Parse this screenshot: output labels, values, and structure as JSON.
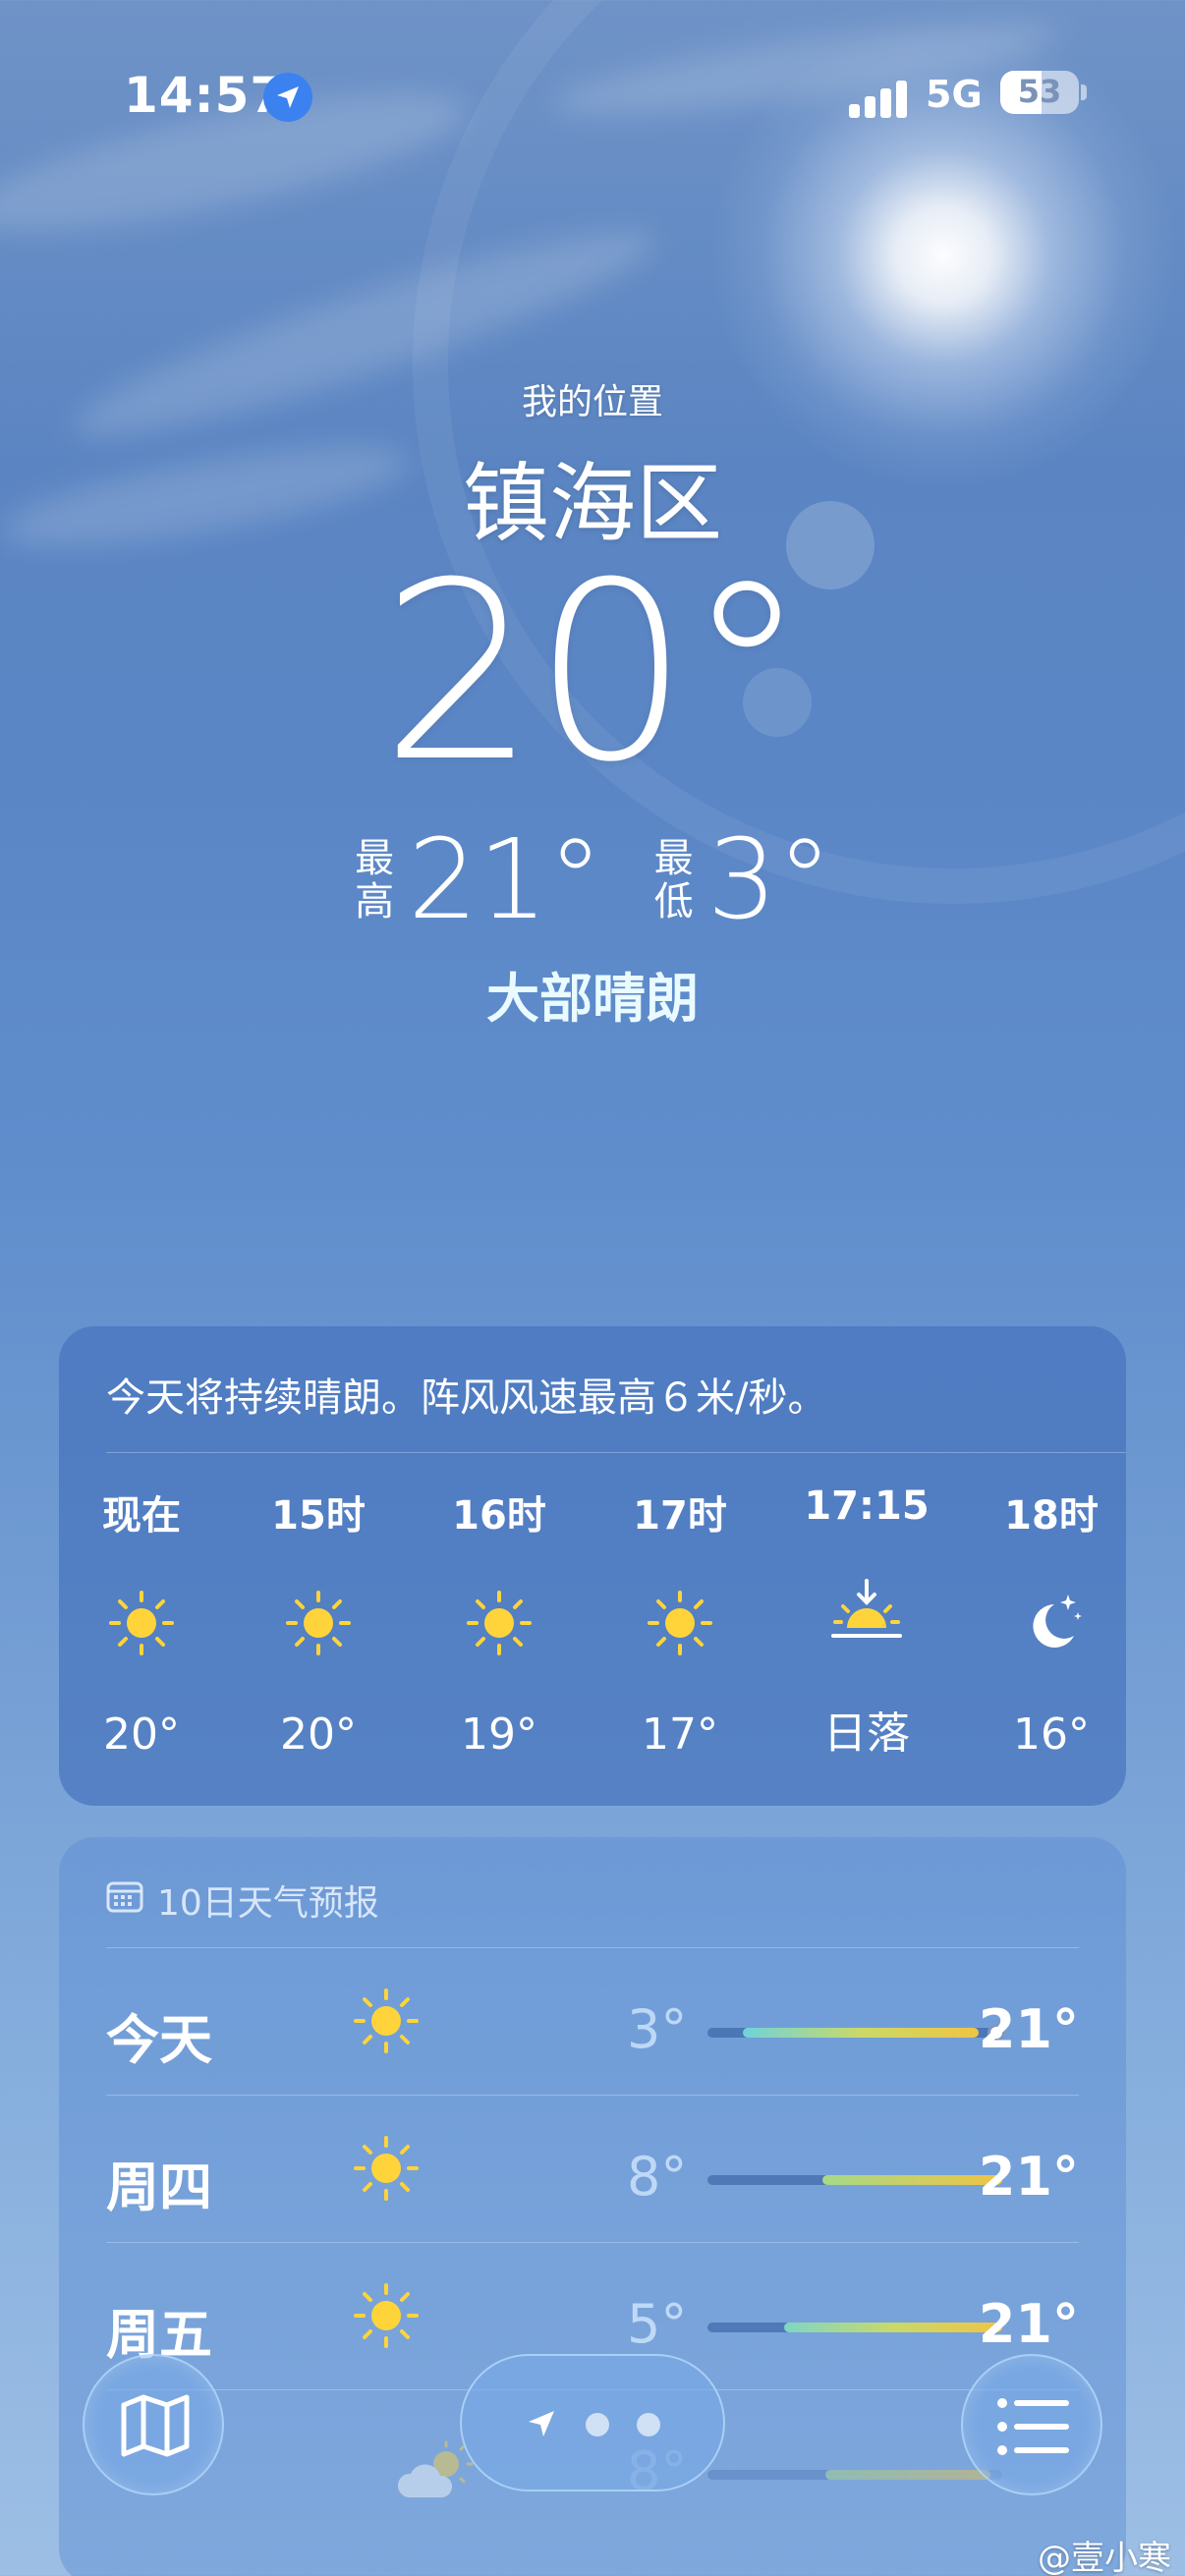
{
  "status_bar": {
    "time": "14:57",
    "network": "5G",
    "battery_level": "53",
    "battery_fraction": 0.53
  },
  "location": {
    "my_location_label": "我的位置",
    "city": "镇海区"
  },
  "current": {
    "temperature": "20°",
    "high_label": "最高",
    "high": "21°",
    "low_label": "最低",
    "low": "3°",
    "condition": "大部晴朗"
  },
  "hourly": {
    "summary": "今天将持续晴朗。阵风风速最高６米/秒。",
    "items": [
      {
        "time": "现在",
        "icon": "sun-icon",
        "temp": "20°"
      },
      {
        "time": "15时",
        "icon": "sun-icon",
        "temp": "20°"
      },
      {
        "time": "16时",
        "icon": "sun-icon",
        "temp": "19°"
      },
      {
        "time": "17时",
        "icon": "sun-icon",
        "temp": "17°"
      },
      {
        "time": "17:15",
        "icon": "sunset-icon",
        "temp": "日落"
      },
      {
        "time": "18时",
        "icon": "moon-stars-icon",
        "temp": "16°"
      }
    ]
  },
  "daily": {
    "title": "10日天气预报",
    "days": [
      {
        "day": "今天",
        "icon": "sun-icon",
        "low": "3°",
        "high": "21°",
        "range_start": 0.12,
        "range_end": 0.92,
        "current_pos": 0.98
      },
      {
        "day": "周四",
        "icon": "sun-icon",
        "low": "8°",
        "high": "21°",
        "range_start": 0.39,
        "range_end": 1.0
      },
      {
        "day": "周五",
        "icon": "sun-icon",
        "low": "5°",
        "high": "21°",
        "range_start": 0.26,
        "range_end": 1.0
      },
      {
        "day": "",
        "icon": "partly-cloudy-icon",
        "low": "8°",
        "high": "",
        "range_start": 0.4,
        "range_end": 0.96
      }
    ]
  },
  "nav": {
    "map_icon": "map-icon",
    "list_icon": "list-icon"
  },
  "watermark": "@壹小寒",
  "colors": {
    "sun": "#ffd43a",
    "accent_blue": "#3b82f0",
    "condition_text": "#e9fbff"
  }
}
